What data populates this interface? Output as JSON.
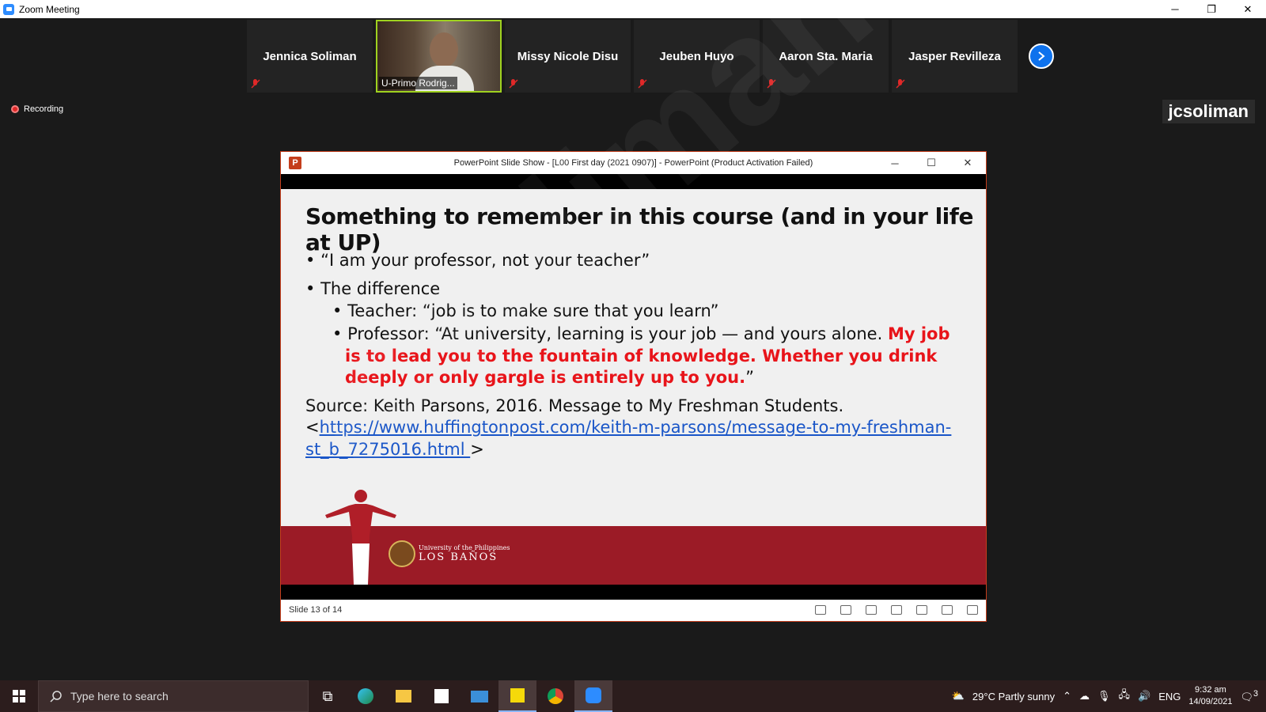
{
  "window": {
    "title": "Zoom Meeting"
  },
  "window_controls": {
    "minimize": "─",
    "restore": "❐",
    "close": "✕"
  },
  "participants": [
    {
      "name": "Jennica Soliman",
      "muted": true,
      "video": false
    },
    {
      "name": "U-Primo Rodrig...",
      "muted": false,
      "video": true
    },
    {
      "name": "Missy Nicole Disu",
      "muted": true,
      "video": false
    },
    {
      "name": "Jeuben Huyo",
      "muted": true,
      "video": false
    },
    {
      "name": "Aaron Sta. Maria",
      "muted": true,
      "video": false
    },
    {
      "name": "Jasper Revilleza",
      "muted": true,
      "video": false
    }
  ],
  "recording": {
    "label": "Recording"
  },
  "speaker": {
    "label": "jcsoliman"
  },
  "watermark": "jcsoliman",
  "ppt": {
    "title": "PowerPoint Slide Show - [L00 First day (2021 0907)] - PowerPoint (Product Activation Failed)",
    "icon_label": "P",
    "slide": {
      "title": "Something to remember in this course (and in your life at UP)",
      "bullet1": "“I am your professor, not your teacher”",
      "bullet2": "The difference",
      "sub1": "Teacher: “job is to make sure that you learn”",
      "sub2_plain": "Professor:  “At university, learning is your job — and yours alone. ",
      "sub2_red": "My job is to lead you to the fountain of knowledge. Whether you drink deeply or only gargle is entirely up to you.",
      "sub2_end": "”",
      "source_text": "Source: Keith Parsons, 2016. Message to My Freshman Students.",
      "source_lt": "<",
      "source_link": "https://www.huffingtonpost.com/keith-m-parsons/message-to-my-freshman-st_b_7275016.html ",
      "source_gt": ">",
      "logo_small": "University of the Philippines",
      "logo_big": "LOS BAÑOS"
    },
    "status": "Slide 13 of 14"
  },
  "taskbar": {
    "search_placeholder": "Type here to search",
    "weather": "29°C  Partly sunny",
    "lang": "ENG",
    "time": "9:32 am",
    "date": "14/09/2021",
    "notifications": "3"
  }
}
